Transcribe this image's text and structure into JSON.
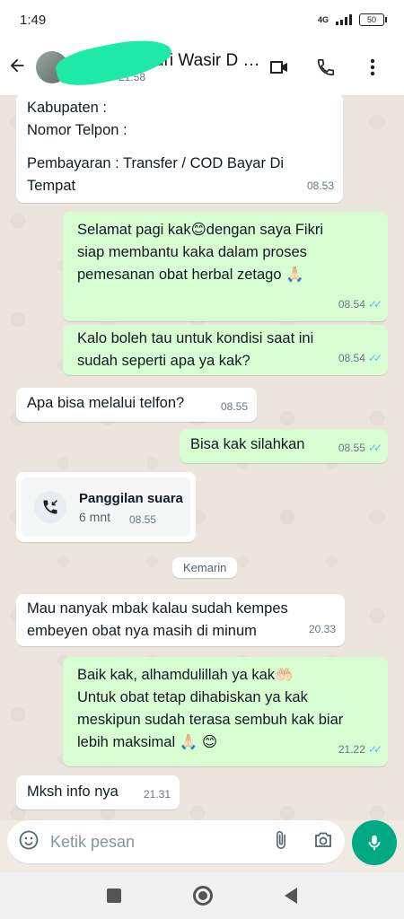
{
  "status_bar": {
    "time": "1:49",
    "network": "4G",
    "battery": "50"
  },
  "header": {
    "contact_name": "dri Wasir D 5 3...",
    "last_seen": "21.58"
  },
  "messages": [
    {
      "direction": "in",
      "lines": [
        "Kabupaten :",
        "Nomor Telpon :",
        "",
        "Pembayaran : Transfer / COD Bayar Di",
        "Tempat"
      ],
      "time": "08.53"
    },
    {
      "direction": "out",
      "lines": [
        "Selamat pagi kak😊dengan saya Fikri",
        "siap membantu kaka dalam proses",
        "pemesanan obat herbal zetago 🙏🏻"
      ],
      "time": "08.54",
      "read": true
    },
    {
      "direction": "out",
      "lines": [
        "Kalo boleh tau untuk kondisi saat ini",
        "sudah seperti apa ya kak?"
      ],
      "time": "08.54",
      "read": true
    },
    {
      "direction": "in",
      "lines": [
        "Apa bisa melalui telfon?"
      ],
      "time": "08.55"
    },
    {
      "direction": "out",
      "lines": [
        "Bisa kak silahkan"
      ],
      "time": "08.55",
      "read": true
    },
    {
      "direction": "in",
      "lines": [
        "Mau nanyak mbak kalau sudah kempes",
        "embeyen obat nya masih di minum"
      ],
      "time": "20.33"
    },
    {
      "direction": "out",
      "lines": [
        "Baik kak, alhamdulillah ya kak🤲🏻",
        "Untuk obat tetap dihabiskan ya kak",
        "meskipun sudah terasa sembuh kak biar",
        "lebih maksimal 🙏🏻 😊"
      ],
      "time": "21.22",
      "read": true
    },
    {
      "direction": "in",
      "lines": [
        "Mksh info nya"
      ],
      "time": "21.31"
    }
  ],
  "call": {
    "title": "Panggilan suara",
    "duration": "6 mnt",
    "time": "08.55"
  },
  "date_divider": "Kemarin",
  "composer": {
    "placeholder": "Ketik pesan"
  },
  "colors": {
    "outgoing": "#d9fdd3",
    "incoming": "#ffffff",
    "accent": "#00a884",
    "read_ticks": "#53bdeb"
  },
  "icons": [
    "back-arrow-icon",
    "video-call-icon",
    "phone-icon",
    "more-vert-icon",
    "emoji-icon",
    "attach-icon",
    "camera-icon",
    "mic-icon",
    "missed-call-icon"
  ]
}
